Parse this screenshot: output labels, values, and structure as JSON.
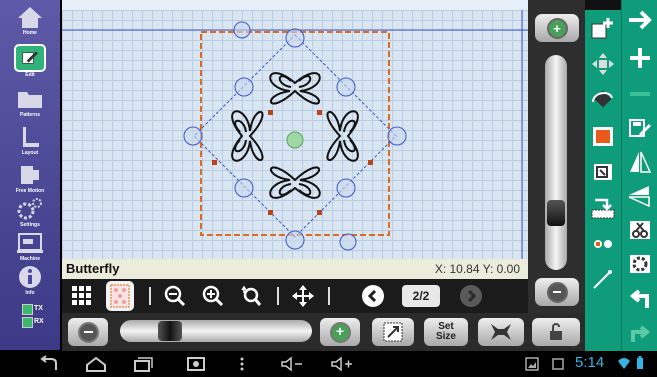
{
  "sidebar": {
    "items": [
      {
        "label": "Home",
        "icon": "home-icon"
      },
      {
        "label": "Edit",
        "icon": "edit-icon"
      },
      {
        "label": "Patterns",
        "icon": "folder-icon"
      },
      {
        "label": "Layout",
        "icon": "layout-icon"
      },
      {
        "label": "Free Motion",
        "icon": "free-motion-icon"
      },
      {
        "label": "Settings",
        "icon": "gears-icon"
      },
      {
        "label": "Machine",
        "icon": "machine-icon"
      },
      {
        "label": "Info",
        "icon": "info-icon"
      }
    ],
    "tx_label": "TX",
    "rx_label": "RX",
    "tx_color": "#3db86b",
    "rx_color": "#3db86b"
  },
  "pattern": {
    "name": "Butterfly",
    "coords": "X: 10.84 Y: 0.00"
  },
  "toolbar1": {
    "page_indicator": "2/2"
  },
  "toolbar2": {
    "set_size_label": "Set\nSize"
  },
  "navbar": {
    "time": "5:14"
  },
  "colors": {
    "accent_green": "#0f9c7a",
    "sidebar_purple": "#4b48a0",
    "guide_orange": "#e06a1e",
    "handle_blue": "#3a56c8"
  }
}
